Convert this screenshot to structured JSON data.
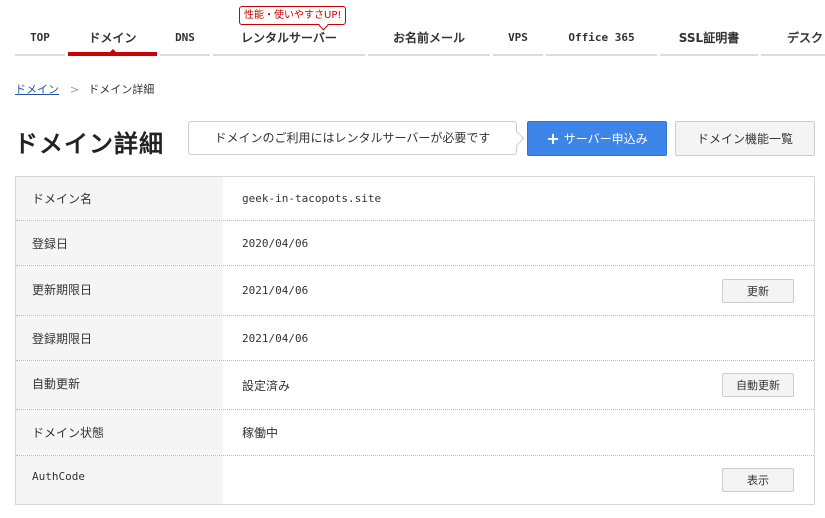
{
  "nav": {
    "items": [
      {
        "label": "TOP",
        "active": false
      },
      {
        "label": "ドメイン",
        "active": true
      },
      {
        "label": "DNS",
        "active": false
      },
      {
        "label": "レンタルサーバー",
        "active": false
      },
      {
        "label": "お名前メール",
        "active": false
      },
      {
        "label": "VPS",
        "active": false
      },
      {
        "label": "Office 365",
        "active": false
      },
      {
        "label": "SSL証明書",
        "active": false
      },
      {
        "label": "デスク",
        "active": false
      }
    ],
    "badge": "性能・使いやすさUP!"
  },
  "breadcrumb": {
    "parent": "ドメイン",
    "separator": ">",
    "current": "ドメイン詳細"
  },
  "header": {
    "title": "ドメイン詳細",
    "notice": "ドメインのご利用にはレンタルサーバーが必要です",
    "primary_button": "サーバー申込み",
    "secondary_button": "ドメイン機能一覧"
  },
  "details": [
    {
      "label": "ドメイン名",
      "value": "geek-in-tacopots.site",
      "button": null
    },
    {
      "label": "登録日",
      "value": "2020/04/06",
      "button": null
    },
    {
      "label": "更新期限日",
      "value": "2021/04/06",
      "button": "更新"
    },
    {
      "label": "登録期限日",
      "value": "2021/04/06",
      "button": null
    },
    {
      "label": "自動更新",
      "value": "設定済み",
      "button": "自動更新"
    },
    {
      "label": "ドメイン状態",
      "value": "稼働中",
      "button": null
    },
    {
      "label": "AuthCode",
      "value": "",
      "button": "表示"
    }
  ]
}
